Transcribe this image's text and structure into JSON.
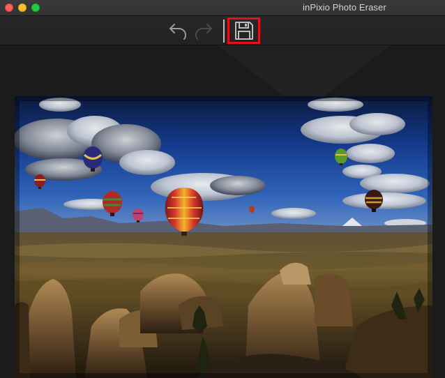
{
  "window": {
    "title": "inPixio Photo Eraser"
  },
  "toolbar": {
    "buttons": [
      {
        "name": "undo",
        "icon": "undo-arrow-icon"
      },
      {
        "name": "redo",
        "icon": "redo-arrow-icon"
      },
      {
        "name": "save",
        "icon": "floppy-disk-icon",
        "highlighted": true
      }
    ]
  },
  "colors": {
    "highlight": "#e3111a",
    "titlebar": "#353535",
    "toolbar": "#252525",
    "workspace": "#1b1b1b"
  },
  "photo": {
    "subject": "hot-air-balloons-over-rocky-valley"
  }
}
